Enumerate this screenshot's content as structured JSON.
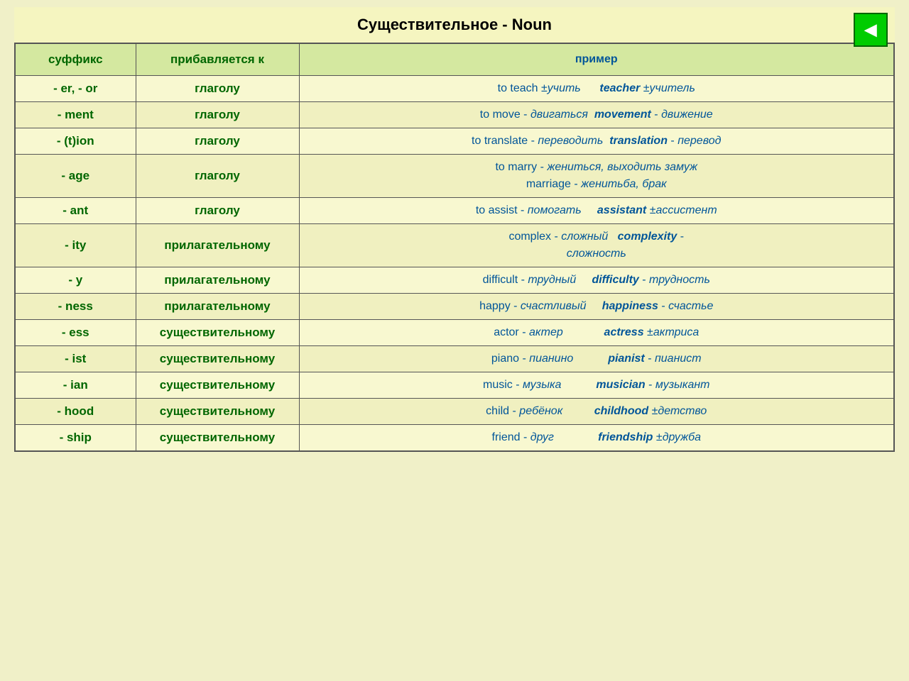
{
  "title": "Существительное - Noun",
  "nav_button": "◀",
  "headers": {
    "suffix": "суффикс",
    "added_to": "прибавляется к",
    "example": "пример"
  },
  "rows": [
    {
      "suffix": "- er, - or",
      "added_to": "глаголу",
      "example_html": "to teach ±<i>учить</i> &nbsp;&nbsp;&nbsp;&nbsp; <i><b>teacher</b></i> ±<i>учитель</i>"
    },
    {
      "suffix": "- ment",
      "added_to": "глаголу",
      "example_html": "to move - <i>двигаться</i> &nbsp;<i><b>movement</b></i> - <i>движение</i>"
    },
    {
      "suffix": "- (t)ion",
      "added_to": "глаголу",
      "example_html": "to translate - <i>переводить</i> &nbsp;<i><b>translation</b></i> - <i>перевод</i>"
    },
    {
      "suffix": "- age",
      "added_to": "глаголу",
      "example_html": "to marry - <i>жениться, выходить замуж</i><br>marriage - <i>женитьба, брак</i>"
    },
    {
      "suffix": "- ant",
      "added_to": "глаголу",
      "example_html": "to assist - <i>помогать</i> &nbsp;&nbsp;&nbsp; <i><b>assistant</b></i> ±<i>ассистент</i>"
    },
    {
      "suffix": "- ity",
      "added_to": "прилагательному",
      "example_html": "complex - <i>сложный</i> &nbsp;&nbsp;<i><b>complexity</b></i> -<br><i>сложность</i>"
    },
    {
      "suffix": "- y",
      "added_to": "прилагательному",
      "example_html": "difficult - <i>трудный</i> &nbsp;&nbsp;&nbsp; <i><b>difficulty</b></i> - <i>трудность</i>"
    },
    {
      "suffix": "- ness",
      "added_to": "прилагательному",
      "example_html": "happy - <i>счастливый</i> &nbsp;&nbsp;&nbsp; <i><b>happiness</b></i> - <i>счастье</i>"
    },
    {
      "suffix": "- ess",
      "added_to": "существительному",
      "example_html": "actor - <i>актер</i> &nbsp;&nbsp;&nbsp;&nbsp;&nbsp;&nbsp;&nbsp;&nbsp;&nbsp;&nbsp;&nbsp; <i><b>actress</b></i> ±<i>актриса</i>"
    },
    {
      "suffix": "- ist",
      "added_to": "существительному",
      "example_html": "piano - <i>пианино</i> &nbsp;&nbsp;&nbsp;&nbsp;&nbsp;&nbsp;&nbsp;&nbsp;&nbsp; <i><b>pianist</b></i> - <i>пианист</i>"
    },
    {
      "suffix": "- ian",
      "added_to": "существительному",
      "example_html": "music - <i>музыка</i> &nbsp;&nbsp;&nbsp;&nbsp;&nbsp;&nbsp;&nbsp;&nbsp;&nbsp; <i><b>musician</b></i> - <i>музыкант</i>"
    },
    {
      "suffix": "- hood",
      "added_to": "существительному",
      "example_html": "child - <i>ребёнок</i> &nbsp;&nbsp;&nbsp;&nbsp;&nbsp;&nbsp;&nbsp;&nbsp; <i><b>childhood</b></i> ±<i>детство</i>"
    },
    {
      "suffix": "- ship",
      "added_to": "существительному",
      "example_html": "friend - <i>друг</i> &nbsp;&nbsp;&nbsp;&nbsp;&nbsp;&nbsp;&nbsp;&nbsp;&nbsp;&nbsp;&nbsp;&nbsp; <i><b>friendship</b></i> ±<i>дружба</i>"
    }
  ]
}
